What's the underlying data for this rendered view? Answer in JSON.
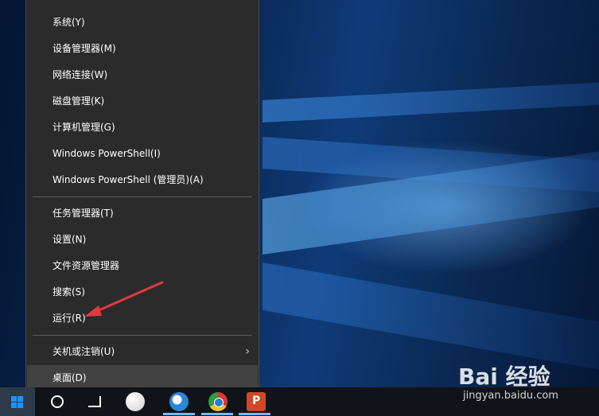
{
  "menu": {
    "items": [
      {
        "label": "系统(Y)"
      },
      {
        "label": "设备管理器(M)"
      },
      {
        "label": "网络连接(W)"
      },
      {
        "label": "磁盘管理(K)"
      },
      {
        "label": "计算机管理(G)"
      },
      {
        "label": "Windows PowerShell(I)"
      },
      {
        "label": "Windows PowerShell (管理员)(A)"
      },
      {
        "label": "任务管理器(T)"
      },
      {
        "label": "设置(N)"
      },
      {
        "label": "文件资源管理器"
      },
      {
        "label": "搜索(S)"
      },
      {
        "label": "运行(R)"
      },
      {
        "label": "关机或注销(U)"
      },
      {
        "label": "桌面(D)"
      }
    ],
    "submenu_glyph": "›",
    "highlighted_item": "桌面(D)"
  },
  "taskbar": {
    "icons": [
      "windows-start-icon",
      "cortana-icon",
      "task-view-icon",
      "app-icon",
      "browser-icon",
      "chrome-icon",
      "powerpoint-icon"
    ]
  },
  "watermark": {
    "logo": "Bai 经验",
    "url": "jingyan.baidu.com"
  },
  "annotation": {
    "arrow_color": "#e0393e"
  }
}
